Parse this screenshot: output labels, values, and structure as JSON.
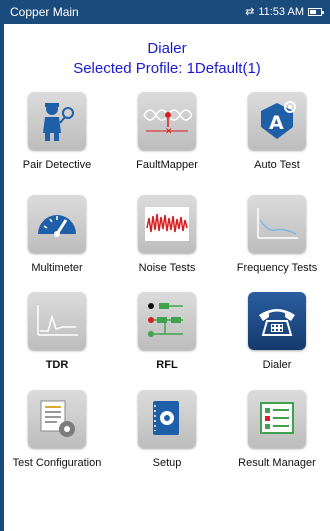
{
  "status_bar": {
    "app_title": "Copper Main",
    "time": "11:53 AM",
    "battery_level": 0.6
  },
  "header": {
    "title": "Dialer",
    "profile": "Selected Profile:  1Default(1)"
  },
  "tiles": [
    {
      "label": "Pair Detective",
      "icon": "detective-icon"
    },
    {
      "label": "FaultMapper",
      "icon": "fault-mapper-icon"
    },
    {
      "label": "Auto Test",
      "icon": "auto-test-icon"
    },
    {
      "label": "Multimeter",
      "icon": "multimeter-icon"
    },
    {
      "label": "Noise Tests",
      "icon": "noise-icon"
    },
    {
      "label": "Frequency Tests",
      "icon": "frequency-icon"
    },
    {
      "label": "TDR",
      "icon": "tdr-icon"
    },
    {
      "label": "RFL",
      "icon": "rfl-icon"
    },
    {
      "label": "Dialer",
      "icon": "telephone-icon",
      "active": true
    },
    {
      "label": "Test Configuration",
      "icon": "test-config-icon"
    },
    {
      "label": "Setup",
      "icon": "setup-icon"
    },
    {
      "label": "Result Manager",
      "icon": "result-manager-icon"
    }
  ],
  "colors": {
    "accent": "#1b4a7c",
    "header_text": "#1a1ad0",
    "active_tile": "#1f4c86"
  }
}
